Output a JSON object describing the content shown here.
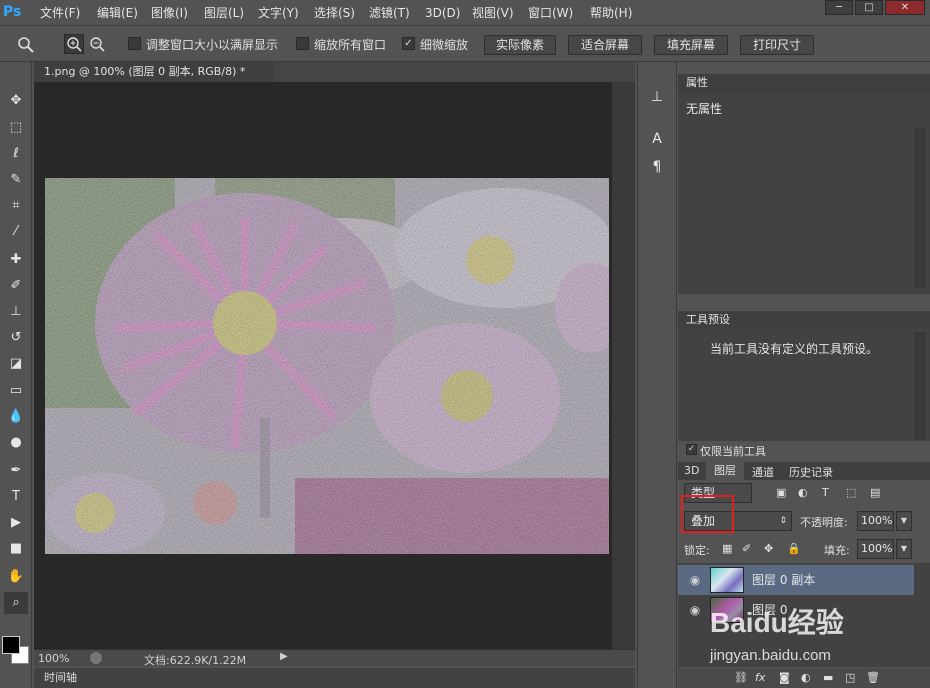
{
  "app": {
    "logo": "Ps"
  },
  "menubar": {
    "items": [
      "文件(F)",
      "编辑(E)",
      "图像(I)",
      "图层(L)",
      "文字(Y)",
      "选择(S)",
      "滤镜(T)",
      "3D(D)",
      "视图(V)",
      "窗口(W)",
      "帮助(H)"
    ]
  },
  "window_controls": {
    "minimize": "─",
    "maximize": "□",
    "close": "✕"
  },
  "options_bar": {
    "resize_windows": {
      "label": "调整窗口大小以满屏显示",
      "checked": false
    },
    "zoom_all": {
      "label": "缩放所有窗口",
      "checked": false
    },
    "scrubby_zoom": {
      "label": "细微缩放",
      "checked": true
    },
    "buttons": [
      "实际像素",
      "适合屏幕",
      "填充屏幕",
      "打印尺寸"
    ]
  },
  "document": {
    "tab_title": "1.png @ 100% (图层 0 副本, RGB/8) *",
    "zoom": "100%",
    "doc_size": "文档:622.9K/1.22M"
  },
  "timeline": {
    "label": "时间轴"
  },
  "properties": {
    "title": "属性",
    "body": "无属性"
  },
  "tool_presets": {
    "title": "工具预设",
    "body": "当前工具没有定义的工具预设。",
    "current_only": "仅限当前工具",
    "current_only_checked": true
  },
  "layers": {
    "tabs": [
      "3D",
      "图层",
      "通道",
      "历史记录"
    ],
    "active_tab": "图层",
    "filter_label": "类型",
    "blend_mode": "叠加",
    "opacity_label": "不透明度:",
    "opacity_value": "100%",
    "lock_label": "锁定:",
    "fill_label": "填充:",
    "fill_value": "100%",
    "items": [
      {
        "name": "图层 0 副本",
        "selected": true
      },
      {
        "name": "图层 0",
        "selected": false
      }
    ],
    "footer_icons": [
      "link-icon",
      "fx-icon",
      "mask-icon",
      "adjustment-icon",
      "group-icon",
      "new-layer-icon",
      "delete-icon"
    ]
  },
  "colors": {
    "accent": "#31a8ff",
    "highlight_box": "#e0201c",
    "selected_layer": "#5a6a82"
  },
  "watermark": {
    "text": "Baidu经验",
    "url": "jingyan.baidu.com"
  }
}
